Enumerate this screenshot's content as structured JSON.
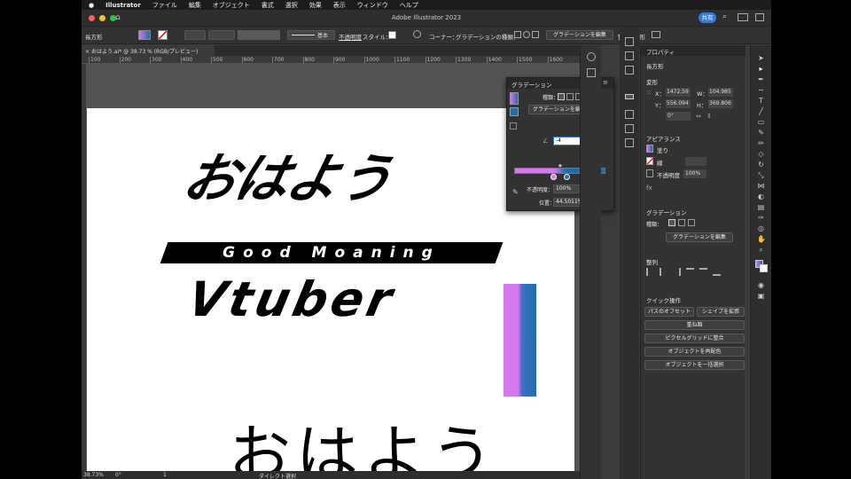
{
  "menubar": {
    "items": [
      "Illustrator",
      "ファイル",
      "編集",
      "オブジェクト",
      "書式",
      "選択",
      "効果",
      "表示",
      "ウィンドウ",
      "ヘルプ"
    ]
  },
  "titlebar": {
    "title": "Adobe Illustrator 2023",
    "share": "共有"
  },
  "control": {
    "object_type": "長方形",
    "stroke_style": "基本",
    "opacity_label": "不透明度",
    "style_label": "スタイル：",
    "corner_label": "コーナー：",
    "gradient_type_label": "グラデーションの種類：",
    "edit_gradient": "グラデーションを編集",
    "align": "整列",
    "transform": "変形"
  },
  "document": {
    "tab_title": "おはよう.ai* @ 38.73 % (RGB/プレビュー)"
  },
  "ruler": {
    "marks": [
      "100",
      "200",
      "300",
      "400",
      "500",
      "600",
      "700",
      "800",
      "900",
      "1000",
      "1100",
      "1200",
      "1300",
      "1400",
      "1500",
      "1600"
    ]
  },
  "artboard": {
    "logo_jp": "おはよう",
    "logo_banner": "Good Moaning",
    "logo_en": "Vtuber",
    "jp_bottom": "おはよう"
  },
  "status": {
    "zoom": "38.73%",
    "angle": "0°",
    "artboard_num": "1",
    "tool": "ダイレクト選択"
  },
  "gradient_panel": {
    "title": "グラデーション",
    "type_label": "種類：",
    "edit_button": "グラデーションを編集",
    "angle_value": "-4",
    "opacity_label": "不透明度：",
    "opacity_value": "100%",
    "position_label": "位置：",
    "position_value": "44.5011%",
    "colors": {
      "start": "#d479ee",
      "end": "#1e6fa8"
    }
  },
  "properties": {
    "tab": "プロパティ",
    "selection": "長方形",
    "transform": {
      "title": "変形",
      "x_label": "X：",
      "x_value": "1472.59",
      "w_label": "W：",
      "w_value": "104.985",
      "y_label": "Y：",
      "y_value": "556.094",
      "h_label": "H：",
      "h_value": "369.806",
      "angle_value": "0°"
    },
    "appearance": {
      "title": "アピアランス",
      "fill": "塗り",
      "stroke": "線",
      "opacity": "不透明度",
      "opacity_value": "100%"
    },
    "gradient": {
      "title": "グラデーション",
      "type_label": "種類：",
      "edit_button": "グラデーションを編集"
    },
    "align": {
      "title": "整列"
    },
    "quick_actions": {
      "title": "クイック操作",
      "offset_path": "パスのオフセット",
      "expand_shape": "シェイプを拡張",
      "arrange": "重ね順",
      "pixel_grid": "ピクセルグリッドに整合",
      "recolor": "オブジェクトを再配色",
      "select_same": "オブジェクトを一括選択"
    }
  }
}
